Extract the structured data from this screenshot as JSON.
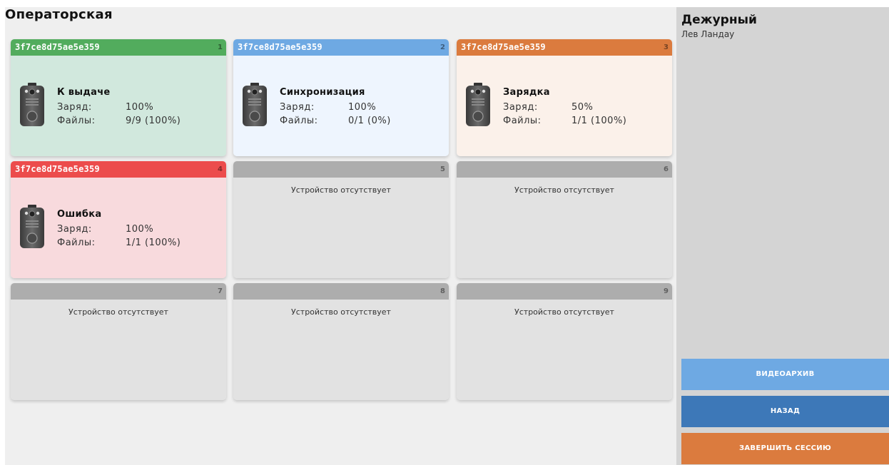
{
  "page_title": "Операторская",
  "side": {
    "title": "Дежурный",
    "user": "Лев Ландау",
    "buttons": {
      "archive": "ВИДЕОАРХИВ",
      "back": "НАЗАД",
      "end_session": "ЗАВЕРШИТЬ СЕССИЮ"
    },
    "button_colors": {
      "archive": "#6ea9e3",
      "back": "#3d78b8",
      "end_session": "#db7b3e"
    }
  },
  "labels": {
    "charge": "Заряд:",
    "files": "Файлы:",
    "empty": "Устройство отсутствует"
  },
  "slots": [
    {
      "number": "1",
      "device_id": "3f7ce8d75ae5e359",
      "status": "К выдаче",
      "charge": "100%",
      "files": "9/9 (100%)",
      "header_color": "#52ac5d",
      "body_color": "#d1e8dd"
    },
    {
      "number": "2",
      "device_id": "3f7ce8d75ae5e359",
      "status": "Синхронизация",
      "charge": "100%",
      "files": "0/1 (0%)",
      "header_color": "#6ea9e3",
      "body_color": "#eef5fe"
    },
    {
      "number": "3",
      "device_id": "3f7ce8d75ae5e359",
      "status": "Зарядка",
      "charge": "50%",
      "files": "1/1 (100%)",
      "header_color": "#db7b3e",
      "body_color": "#fbf1ea"
    },
    {
      "number": "4",
      "device_id": "3f7ce8d75ae5e359",
      "status": "Ошибка",
      "charge": "100%",
      "files": "1/1 (100%)",
      "header_color": "#ec4c4c",
      "body_color": "#f8dadd"
    },
    {
      "number": "5",
      "empty": true,
      "header_color": "#adadad",
      "body_color": "#e2e2e2"
    },
    {
      "number": "6",
      "empty": true,
      "header_color": "#adadad",
      "body_color": "#e2e2e2"
    },
    {
      "number": "7",
      "empty": true,
      "header_color": "#adadad",
      "body_color": "#e2e2e2"
    },
    {
      "number": "8",
      "empty": true,
      "header_color": "#adadad",
      "body_color": "#e2e2e2"
    },
    {
      "number": "9",
      "empty": true,
      "header_color": "#adadad",
      "body_color": "#e2e2e2"
    }
  ],
  "device_icon": "body-camera-icon"
}
